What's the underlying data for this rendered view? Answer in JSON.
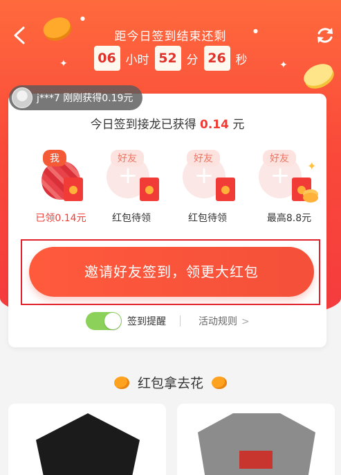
{
  "header": {
    "countdown_title": "距今日签到结束还剩",
    "hours": "06",
    "hours_unit": "小时",
    "minutes": "52",
    "minutes_unit": "分",
    "seconds": "26",
    "seconds_unit": "秒"
  },
  "ticker": {
    "text": "j***7 刚刚获得0.19元"
  },
  "earned": {
    "prefix": "今日签到接龙已获得 ",
    "amount": "0.14",
    "suffix": " 元"
  },
  "friends": [
    {
      "tag": "我",
      "label": "已领0.14元"
    },
    {
      "tag": "好友",
      "label": "红包待领"
    },
    {
      "tag": "好友",
      "label": "红包待领"
    },
    {
      "tag": "好友",
      "label": "最高8.8元"
    }
  ],
  "invite_button": "邀请好友签到，领更大红包",
  "reminder": {
    "label": "签到提醒",
    "on": true
  },
  "rules": {
    "label": "活动规则",
    "chevron": ">"
  },
  "section": {
    "title": "红包拿去花"
  },
  "icons": [
    "back-arrow-icon",
    "refresh-icon",
    "coin-icon",
    "sparkle-icon",
    "plus-icon",
    "red-envelope-icon",
    "chevron-right-icon"
  ],
  "colors": {
    "accent": "#f23a32",
    "hero": "#fa4a3a",
    "toggle_on": "#8bd15a"
  }
}
